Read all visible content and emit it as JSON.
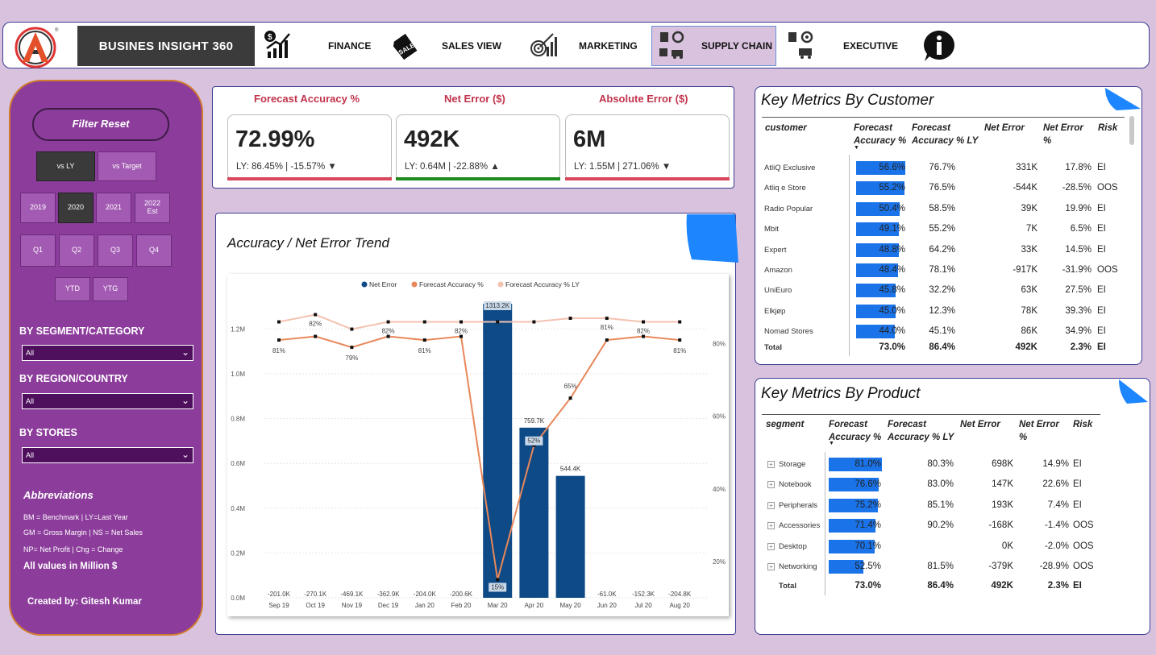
{
  "nav": {
    "brand": "BUSINES INSIGHT 360",
    "items": [
      {
        "label": "FINANCE",
        "icon": "finance-growth-icon"
      },
      {
        "label": "SALES VIEW",
        "icon": "sale-tag-icon"
      },
      {
        "label": "MARKETING",
        "icon": "marketing-target-icon"
      },
      {
        "label": "SUPPLY CHAIN",
        "icon": "supply-chain-icon",
        "selected": true
      },
      {
        "label": "EXECUTIVE",
        "icon": "executive-gear-truck-icon"
      }
    ],
    "info_icon": "info-icon"
  },
  "filters": {
    "reset": "Filter Reset",
    "compare": [
      "vs LY",
      "vs Target"
    ],
    "compare_selected": "vs LY",
    "years": [
      "2019",
      "2020",
      "2021",
      "2022 Est"
    ],
    "year_selected": "2020",
    "quarters": [
      "Q1",
      "Q2",
      "Q3",
      "Q4"
    ],
    "ytd": [
      "YTD",
      "YTG"
    ],
    "segment_label": "BY SEGMENT/CATEGORY",
    "segment_value": "All",
    "region_label": "BY REGION/COUNTRY",
    "region_value": "All",
    "stores_label": "BY STORES",
    "stores_value": "All",
    "abbr_title": "Abbreviations",
    "abbr_lines": [
      "BM = Benchmark | LY=Last Year",
      "GM = Gross Margin | NS = Net Sales",
      "NP= Net Profit | Chg = Change"
    ],
    "values_note": "All values in Million $",
    "credit": "Created by: Gitesh Kumar"
  },
  "kpis": [
    {
      "title": "Forecast Accuracy %",
      "value": "72.99%",
      "sub": "LY: 86.45% | -15.57%",
      "arrow": "▼",
      "bar_color": "#d9475c"
    },
    {
      "title": "Net Error ($)",
      "value": "492K",
      "sub": "LY: 0.64M | -22.88%",
      "arrow": "▲",
      "bar_color": "#1e8a1e"
    },
    {
      "title": "Absolute Error ($)",
      "value": "6M",
      "sub": "LY: 1.55M | 271.06%",
      "arrow": "▼",
      "bar_color": "#d9475c"
    }
  ],
  "trend": {
    "title": "Accuracy / Net Error Trend",
    "legend": [
      "Net Error",
      "Forecast Accuracy %",
      "Forecast Accuracy % LY"
    ],
    "colors": {
      "net_error": "#0e4a86",
      "accuracy": "#e8875a",
      "accuracy_ly": "#f3c2b0"
    }
  },
  "chart_data": {
    "type": "bar",
    "categories": [
      "Sep 19",
      "Oct 19",
      "Nov 19",
      "Dec 19",
      "Jan 20",
      "Feb 20",
      "Mar 20",
      "Apr 20",
      "May 20",
      "Jun 20",
      "Jul 20",
      "Aug 20"
    ],
    "series": [
      {
        "name": "Net Error",
        "type": "bar",
        "axis": "left",
        "values": [
          -201.0,
          -270.1,
          -469.1,
          -362.9,
          -204.0,
          -200.6,
          1313.2,
          759.7,
          544.4,
          -61.0,
          -152.3,
          -204.8
        ],
        "labels": [
          "-201.0K",
          "-270.1K",
          "-469.1K",
          "-362.9K",
          "-204.0K",
          "-200.6K",
          "1313.2K",
          "759.7K",
          "544.4K",
          "-61.0K",
          "-152.3K",
          "-204.8K"
        ]
      },
      {
        "name": "Forecast Accuracy %",
        "type": "line",
        "axis": "right",
        "values": [
          81,
          82,
          79,
          82,
          81,
          82,
          15,
          52,
          65,
          81,
          82,
          81
        ],
        "labels": [
          "81%",
          "",
          "79%",
          "",
          "81%",
          "",
          "15%",
          "52%",
          "65%",
          "",
          "",
          "81%"
        ]
      },
      {
        "name": "Forecast Accuracy % LY",
        "type": "line",
        "axis": "right",
        "values": [
          86,
          88,
          84,
          86,
          86,
          86,
          86,
          86,
          87,
          87,
          86,
          86
        ],
        "labels": [
          "",
          "82%",
          "",
          "82%",
          "",
          "82%",
          "",
          "",
          "",
          "81%",
          "82%",
          ""
        ]
      }
    ],
    "y_left": {
      "ticks": [
        "0.0M",
        "0.2M",
        "0.4M",
        "0.6M",
        "0.8M",
        "1.0M",
        "1.2M"
      ],
      "range": [
        0,
        1.313
      ]
    },
    "y_right": {
      "ticks": [
        "20%",
        "40%",
        "60%",
        "80%"
      ],
      "range": [
        10,
        91
      ]
    },
    "legend_position": "top-center"
  },
  "customer_table": {
    "title": "Key Metrics By Customer",
    "headers": [
      "customer",
      "Forecast Accuracy %",
      "Forecast Accuracy % LY",
      "Net Error",
      "Net Error %",
      "Risk"
    ],
    "rows": [
      {
        "name": "AtliQ Exclusive",
        "acc": 56.6,
        "acc_s": "56.6%",
        "acc_ly": "76.7%",
        "ne": "331K",
        "nep": "17.8%",
        "risk": "EI"
      },
      {
        "name": "Atliq e Store",
        "acc": 55.2,
        "acc_s": "55.2%",
        "acc_ly": "76.5%",
        "ne": "-544K",
        "nep": "-28.5%",
        "risk": "OOS"
      },
      {
        "name": "Radio Popular",
        "acc": 50.4,
        "acc_s": "50.4%",
        "acc_ly": "58.5%",
        "ne": "39K",
        "nep": "19.9%",
        "risk": "EI"
      },
      {
        "name": "Mbit",
        "acc": 49.1,
        "acc_s": "49.1%",
        "acc_ly": "55.2%",
        "ne": "7K",
        "nep": "6.5%",
        "risk": "EI"
      },
      {
        "name": "Expert",
        "acc": 48.8,
        "acc_s": "48.8%",
        "acc_ly": "64.2%",
        "ne": "33K",
        "nep": "14.5%",
        "risk": "EI"
      },
      {
        "name": "Amazon",
        "acc": 48.4,
        "acc_s": "48.4%",
        "acc_ly": "78.1%",
        "ne": "-917K",
        "nep": "-31.9%",
        "risk": "OOS"
      },
      {
        "name": "UniEuro",
        "acc": 45.8,
        "acc_s": "45.8%",
        "acc_ly": "32.2%",
        "ne": "63K",
        "nep": "27.5%",
        "risk": "EI"
      },
      {
        "name": "Elkjøp",
        "acc": 45.0,
        "acc_s": "45.0%",
        "acc_ly": "12.3%",
        "ne": "78K",
        "nep": "39.3%",
        "risk": "EI"
      },
      {
        "name": "Nomad Stores",
        "acc": 44.0,
        "acc_s": "44.0%",
        "acc_ly": "45.1%",
        "ne": "86K",
        "nep": "34.9%",
        "risk": "EI"
      }
    ],
    "total": {
      "name": "Total",
      "acc_s": "73.0%",
      "acc_ly": "86.4%",
      "ne": "492K",
      "nep": "2.3%",
      "risk": "EI"
    }
  },
  "product_table": {
    "title": "Key Metrics By Product",
    "headers": [
      "segment",
      "Forecast Accuracy %",
      "Forecast Accuracy % LY",
      "Net Error",
      "Net Error %",
      "Risk"
    ],
    "rows": [
      {
        "name": "Storage",
        "acc": 81.0,
        "acc_s": "81.0%",
        "acc_ly": "80.3%",
        "ne": "698K",
        "nep": "14.9%",
        "risk": "EI"
      },
      {
        "name": "Notebook",
        "acc": 76.6,
        "acc_s": "76.6%",
        "acc_ly": "83.0%",
        "ne": "147K",
        "nep": "22.6%",
        "risk": "EI"
      },
      {
        "name": "Peripherals",
        "acc": 75.2,
        "acc_s": "75.2%",
        "acc_ly": "85.1%",
        "ne": "193K",
        "nep": "7.4%",
        "risk": "EI"
      },
      {
        "name": "Accessories",
        "acc": 71.4,
        "acc_s": "71.4%",
        "acc_ly": "90.2%",
        "ne": "-168K",
        "nep": "-1.4%",
        "risk": "OOS"
      },
      {
        "name": "Desktop",
        "acc": 70.1,
        "acc_s": "70.1%",
        "acc_ly": "",
        "ne": "0K",
        "nep": "-2.0%",
        "risk": "OOS"
      },
      {
        "name": "Networking",
        "acc": 52.5,
        "acc_s": "52.5%",
        "acc_ly": "81.5%",
        "ne": "-379K",
        "nep": "-28.9%",
        "risk": "OOS"
      }
    ],
    "total": {
      "name": "Total",
      "acc_s": "73.0%",
      "acc_ly": "86.4%",
      "ne": "492K",
      "nep": "2.3%",
      "risk": "EI"
    }
  }
}
